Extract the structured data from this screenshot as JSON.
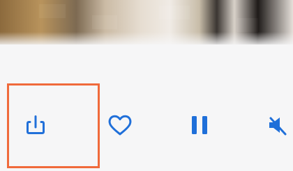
{
  "screen": {
    "photo_strip": {
      "description_icon": "pixelated-image"
    },
    "toolbar": {
      "items": [
        {
          "icon": "share-icon"
        },
        {
          "icon": "heart-icon"
        },
        {
          "icon": "pause-icon"
        },
        {
          "icon": "mute-icon"
        }
      ]
    },
    "highlight": {
      "color": "#f06a3b"
    },
    "accent_color": "#1f6fd9"
  }
}
